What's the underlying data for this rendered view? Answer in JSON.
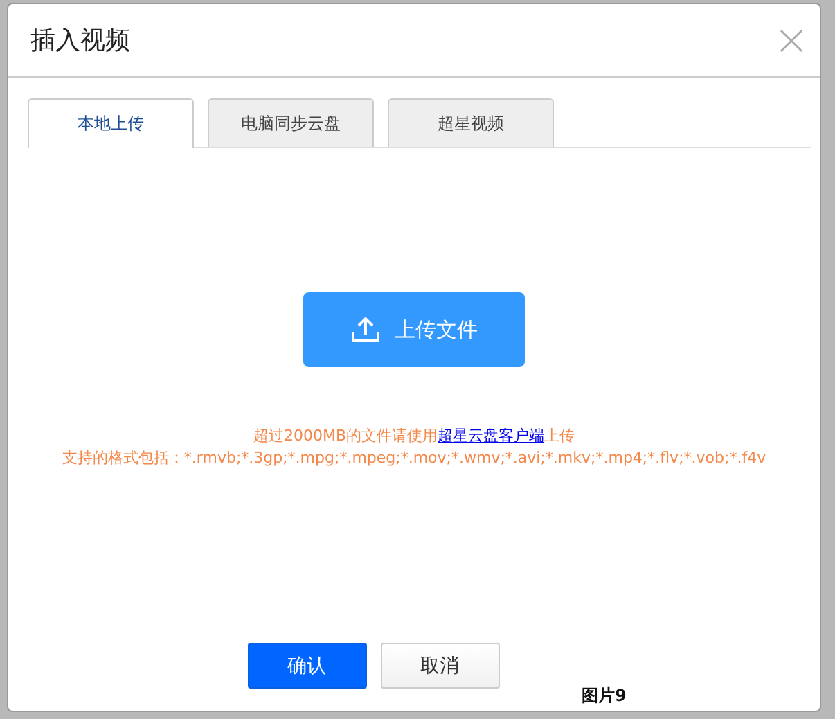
{
  "dialog": {
    "title": "插入视频"
  },
  "tabs": [
    {
      "label": "本地上传",
      "selected": true
    },
    {
      "label": "电脑同步云盘",
      "selected": false
    },
    {
      "label": "超星视频",
      "selected": false
    }
  ],
  "upload_button": "上传文件",
  "notes": [
    {
      "before": "超过2000MB的文件请使用",
      "link": "超星云盘客户端",
      "after": "上传"
    },
    {
      "before": "支持的格式包括：*.rmvb;*.3gp;*.mpg;*.mpeg;*.mov;*.wmv;*.avi;*.mkv;*.mp4;*.flv;*.vob;*.f4v"
    }
  ],
  "buttons": [
    {
      "label": "确认",
      "kind": "primary"
    },
    {
      "label": "取消",
      "kind": "secondary"
    }
  ],
  "caption": "图片9"
}
